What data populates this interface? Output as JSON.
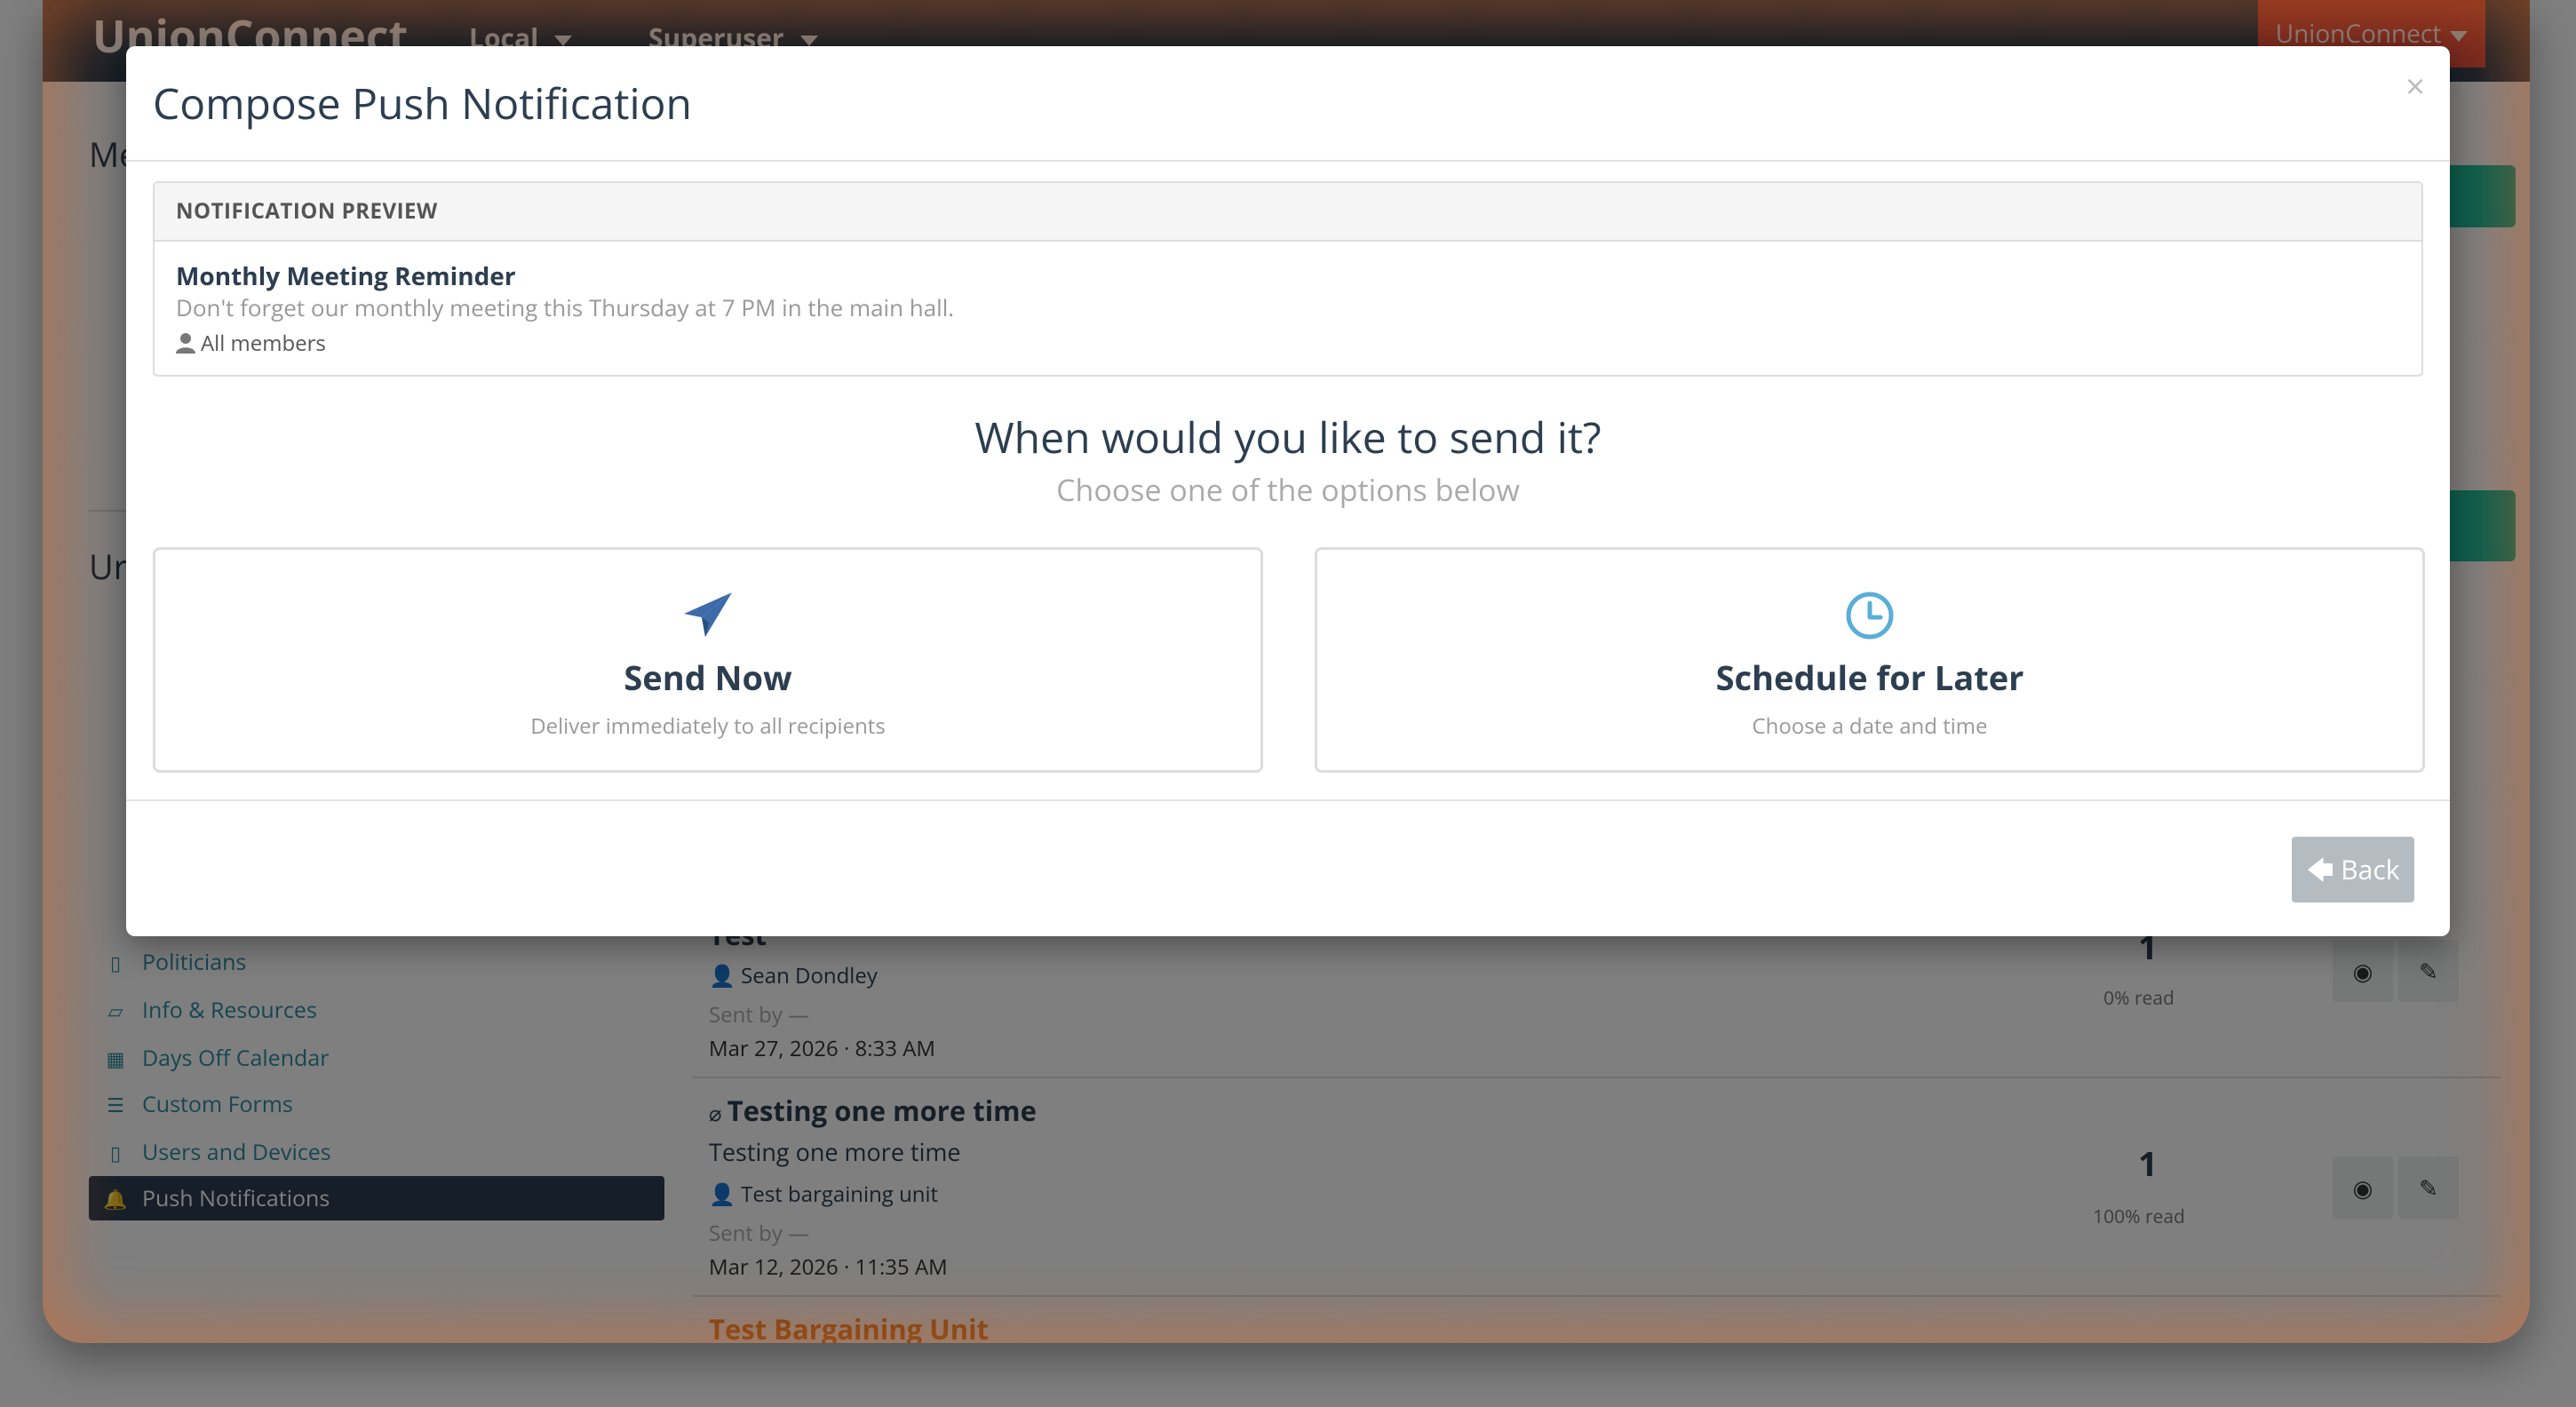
{
  "navbar": {
    "brand": "UnionConnect",
    "menu_local": "Local",
    "menu_superuser": "Superuser",
    "org_button": "UnionConnect"
  },
  "background": {
    "heading_1": "Me",
    "heading_2": "Ur"
  },
  "sidebar": {
    "items": [
      {
        "label": "Politicians",
        "icon": "bookmark-icon"
      },
      {
        "label": "Info & Resources",
        "icon": "folder-open-icon"
      },
      {
        "label": "Days Off Calendar",
        "icon": "calendar-icon"
      },
      {
        "label": "Custom Forms",
        "icon": "list-alt-icon"
      },
      {
        "label": "Users and Devices",
        "icon": "mobile-icon"
      },
      {
        "label": "Push Notifications",
        "icon": "bell-icon",
        "active": true
      }
    ]
  },
  "notifications": [
    {
      "title": "Test",
      "target": "Sean Dondley",
      "sent_by": "Sent by —",
      "date": "Mar 27, 2026 · 8:33 AM",
      "count": "1",
      "read_pct": "0% read"
    },
    {
      "title": "Testing one more time",
      "body": "Testing one more time",
      "target": "Test bargaining unit",
      "sent_by": "Sent by —",
      "date": "Mar 12, 2026 · 11:35 AM",
      "count": "1",
      "read_pct": "100% read"
    },
    {
      "title": "Test Bargaining Unit"
    }
  ],
  "modal": {
    "title": "Compose Push Notification",
    "close_symbol": "×",
    "preview": {
      "header": "NOTIFICATION PREVIEW",
      "title": "Monthly Meeting Reminder",
      "body": "Don't forget our monthly meeting this Thursday at 7 PM in the main hall.",
      "target": "All members"
    },
    "question": "When would you like to send it?",
    "question_sub": "Choose one of the options below",
    "options": [
      {
        "title": "Send Now",
        "description": "Deliver immediately to all recipients",
        "icon": "paper-plane-icon",
        "color": "#3d6aa8"
      },
      {
        "title": "Schedule for Later",
        "description": "Choose a date and time",
        "icon": "clock-icon",
        "color": "#5aaed6"
      }
    ],
    "back_label": "Back"
  },
  "colors": {
    "navbar": "#2c3e50",
    "accent_red": "#e74c3c",
    "accent_green": "#18bc9c",
    "button_disabled": "#b4bcc2"
  }
}
